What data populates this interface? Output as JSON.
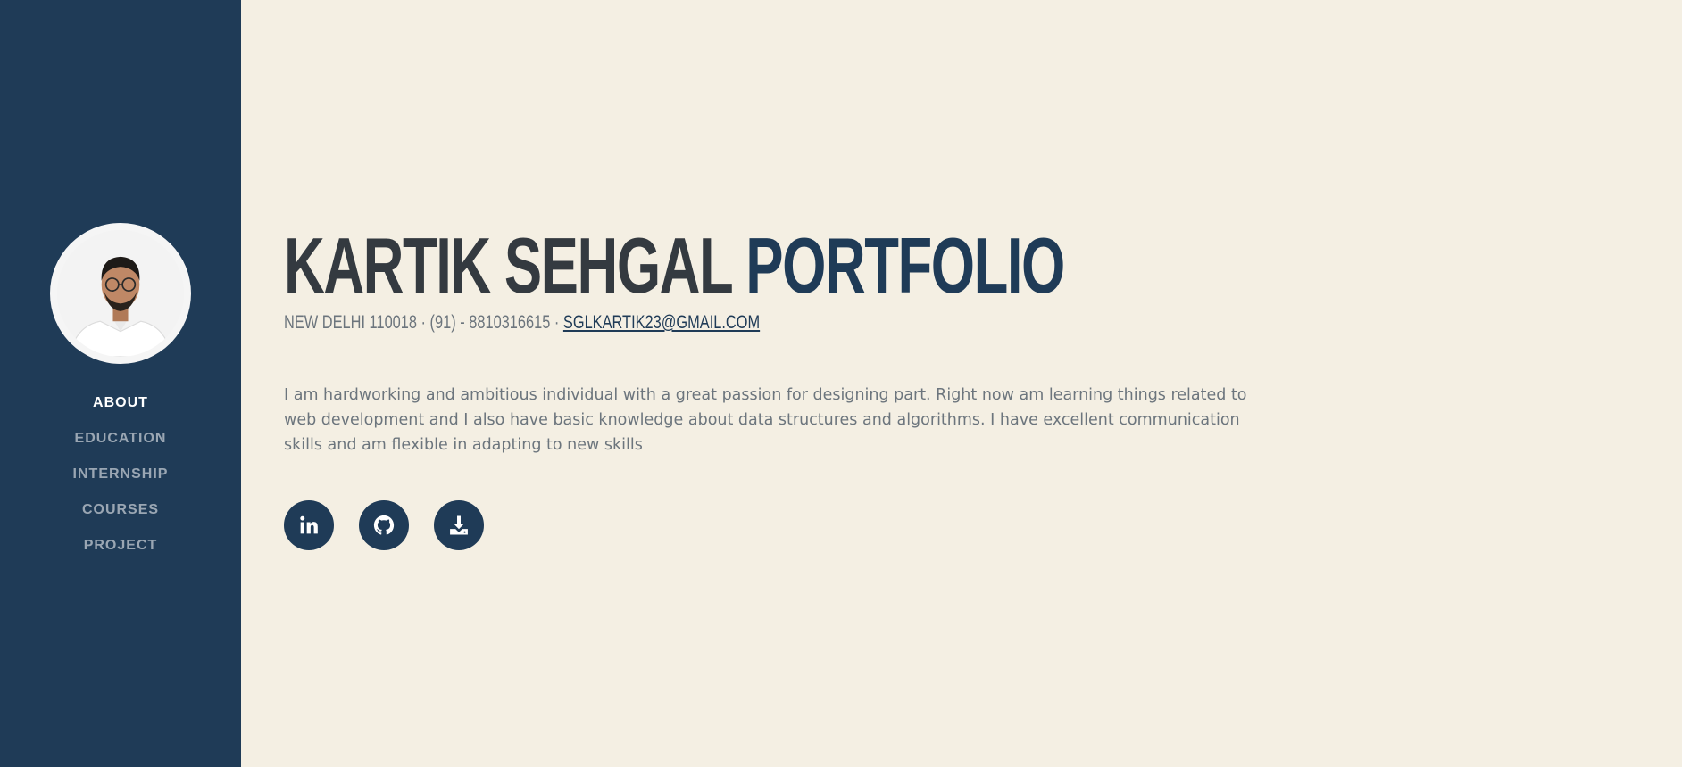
{
  "sidebar": {
    "avatar_alt": "profile photo",
    "nav": [
      {
        "label": "ABOUT",
        "active": true
      },
      {
        "label": "EDUCATION",
        "active": false
      },
      {
        "label": "INTERNSHIP",
        "active": false
      },
      {
        "label": "COURSES",
        "active": false
      },
      {
        "label": "PROJECT",
        "active": false
      }
    ]
  },
  "header": {
    "name": "KARTIK SEHGAL",
    "accent": "PORTFOLIO",
    "contact": "NEW DELHI 110018 · (91) - 8810316615 · ",
    "email": "SGLKARTIK23@GMAIL.COM"
  },
  "about": {
    "text": "I am hardworking and ambitious individual with a great passion for designing part. Right now am learning things related to web development and I also have basic knowledge about data structures and algorithms. I have excellent communication skills and am flexible in adapting to new skills"
  },
  "social": [
    {
      "icon": "linkedin-icon"
    },
    {
      "icon": "github-icon"
    },
    {
      "icon": "download-icon"
    }
  ],
  "colors": {
    "sidebar_bg": "#1f3b57",
    "page_bg": "#f4efe3",
    "heading": "#343a40",
    "accent": "#1f3b57",
    "muted": "#6c757d"
  }
}
